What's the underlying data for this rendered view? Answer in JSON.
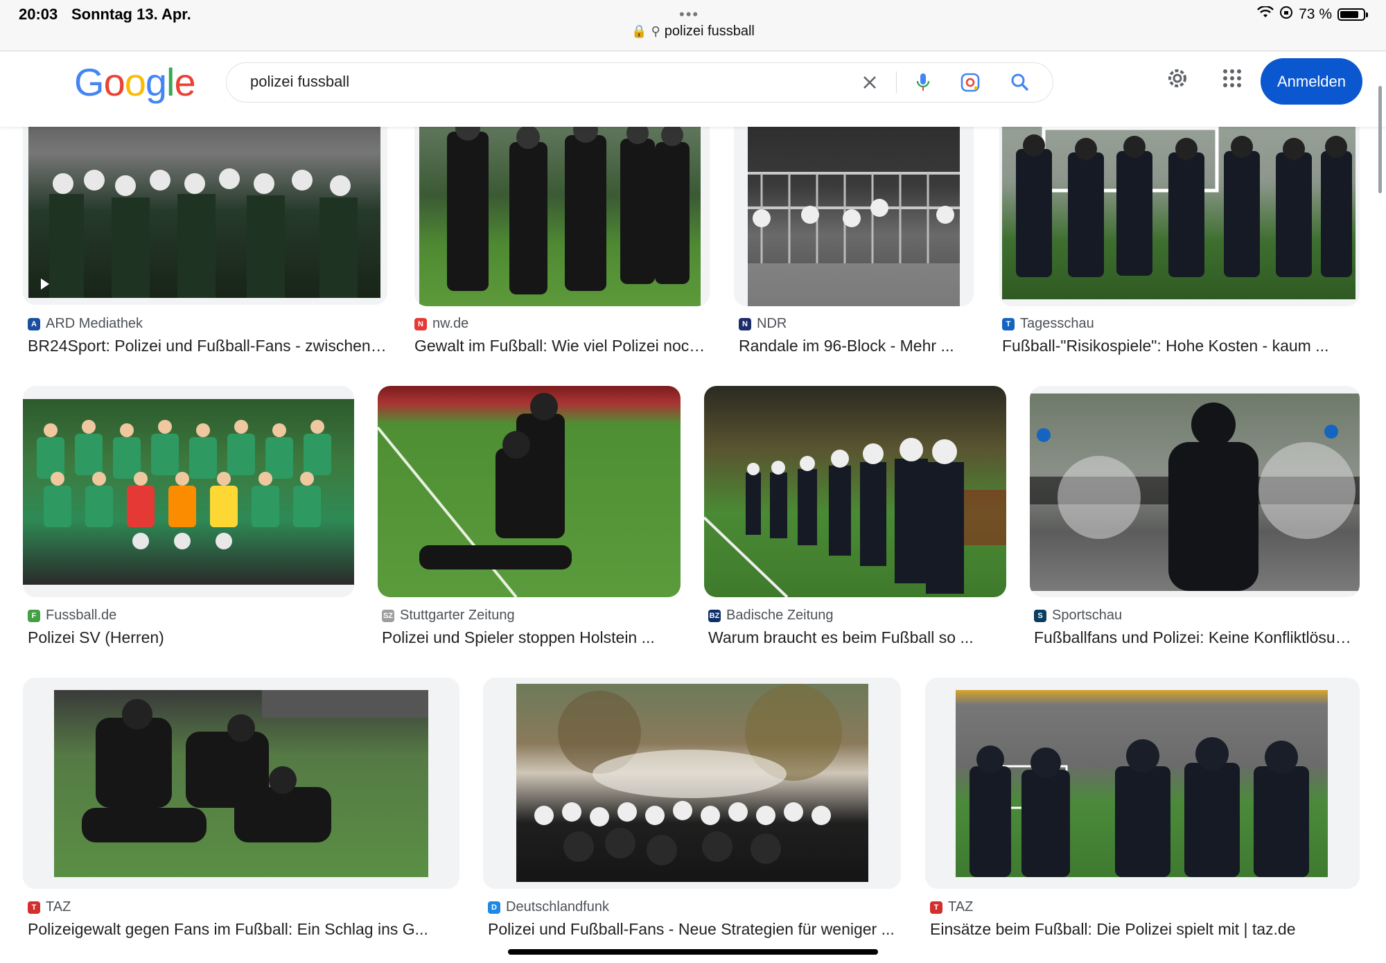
{
  "status": {
    "time": "20:03",
    "date": "Sonntag 13. Apr.",
    "battery": "73 %",
    "battery_level": 0.73
  },
  "url": {
    "text": "polizei fussball"
  },
  "header": {
    "search_value": "polizei fussball",
    "signin_label": "Anmelden"
  },
  "results": [
    {
      "source": "ARD Mediathek",
      "title": "BR24Sport: Polizei und Fußball-Fans - zwischen ...",
      "favicon_color": "#1a4fa0"
    },
    {
      "source": "nw.de",
      "title": "Gewalt im Fußball: Wie viel Polizei noch ...",
      "favicon_color": "#e53935"
    },
    {
      "source": "NDR",
      "title": "Randale im 96-Block - Mehr ...",
      "favicon_color": "#1b2d6b"
    },
    {
      "source": "Tagesschau",
      "title": "Fußball-\"Risikospiele\": Hohe Kosten - kaum ...",
      "favicon_color": "#1565c0"
    },
    {
      "source": "Fussball.de",
      "title": "Polizei SV (Herren)",
      "favicon_color": "#43a047"
    },
    {
      "source": "Stuttgarter Zeitung",
      "title": "Polizei und Spieler stoppen Holstein ...",
      "favicon_color": "#9e9e9e"
    },
    {
      "source": "Badische Zeitung",
      "title": "Warum braucht es beim Fußball so ...",
      "favicon_color": "#0d2f6b"
    },
    {
      "source": "Sportschau",
      "title": "Fußballfans und Polizei: Keine Konfliktlösung ...",
      "favicon_color": "#0a3d62"
    },
    {
      "source": "TAZ",
      "title": "Polizeigewalt gegen Fans im Fußball: Ein Schlag ins G...",
      "favicon_color": "#d32f2f"
    },
    {
      "source": "Deutschlandfunk",
      "title": "Polizei und Fußball-Fans - Neue Strategien für weniger ...",
      "favicon_color": "#1e88e5"
    },
    {
      "source": "TAZ",
      "title": "Einsätze beim Fußball: Die Polizei spielt mit | taz.de",
      "favicon_color": "#d32f2f"
    }
  ]
}
